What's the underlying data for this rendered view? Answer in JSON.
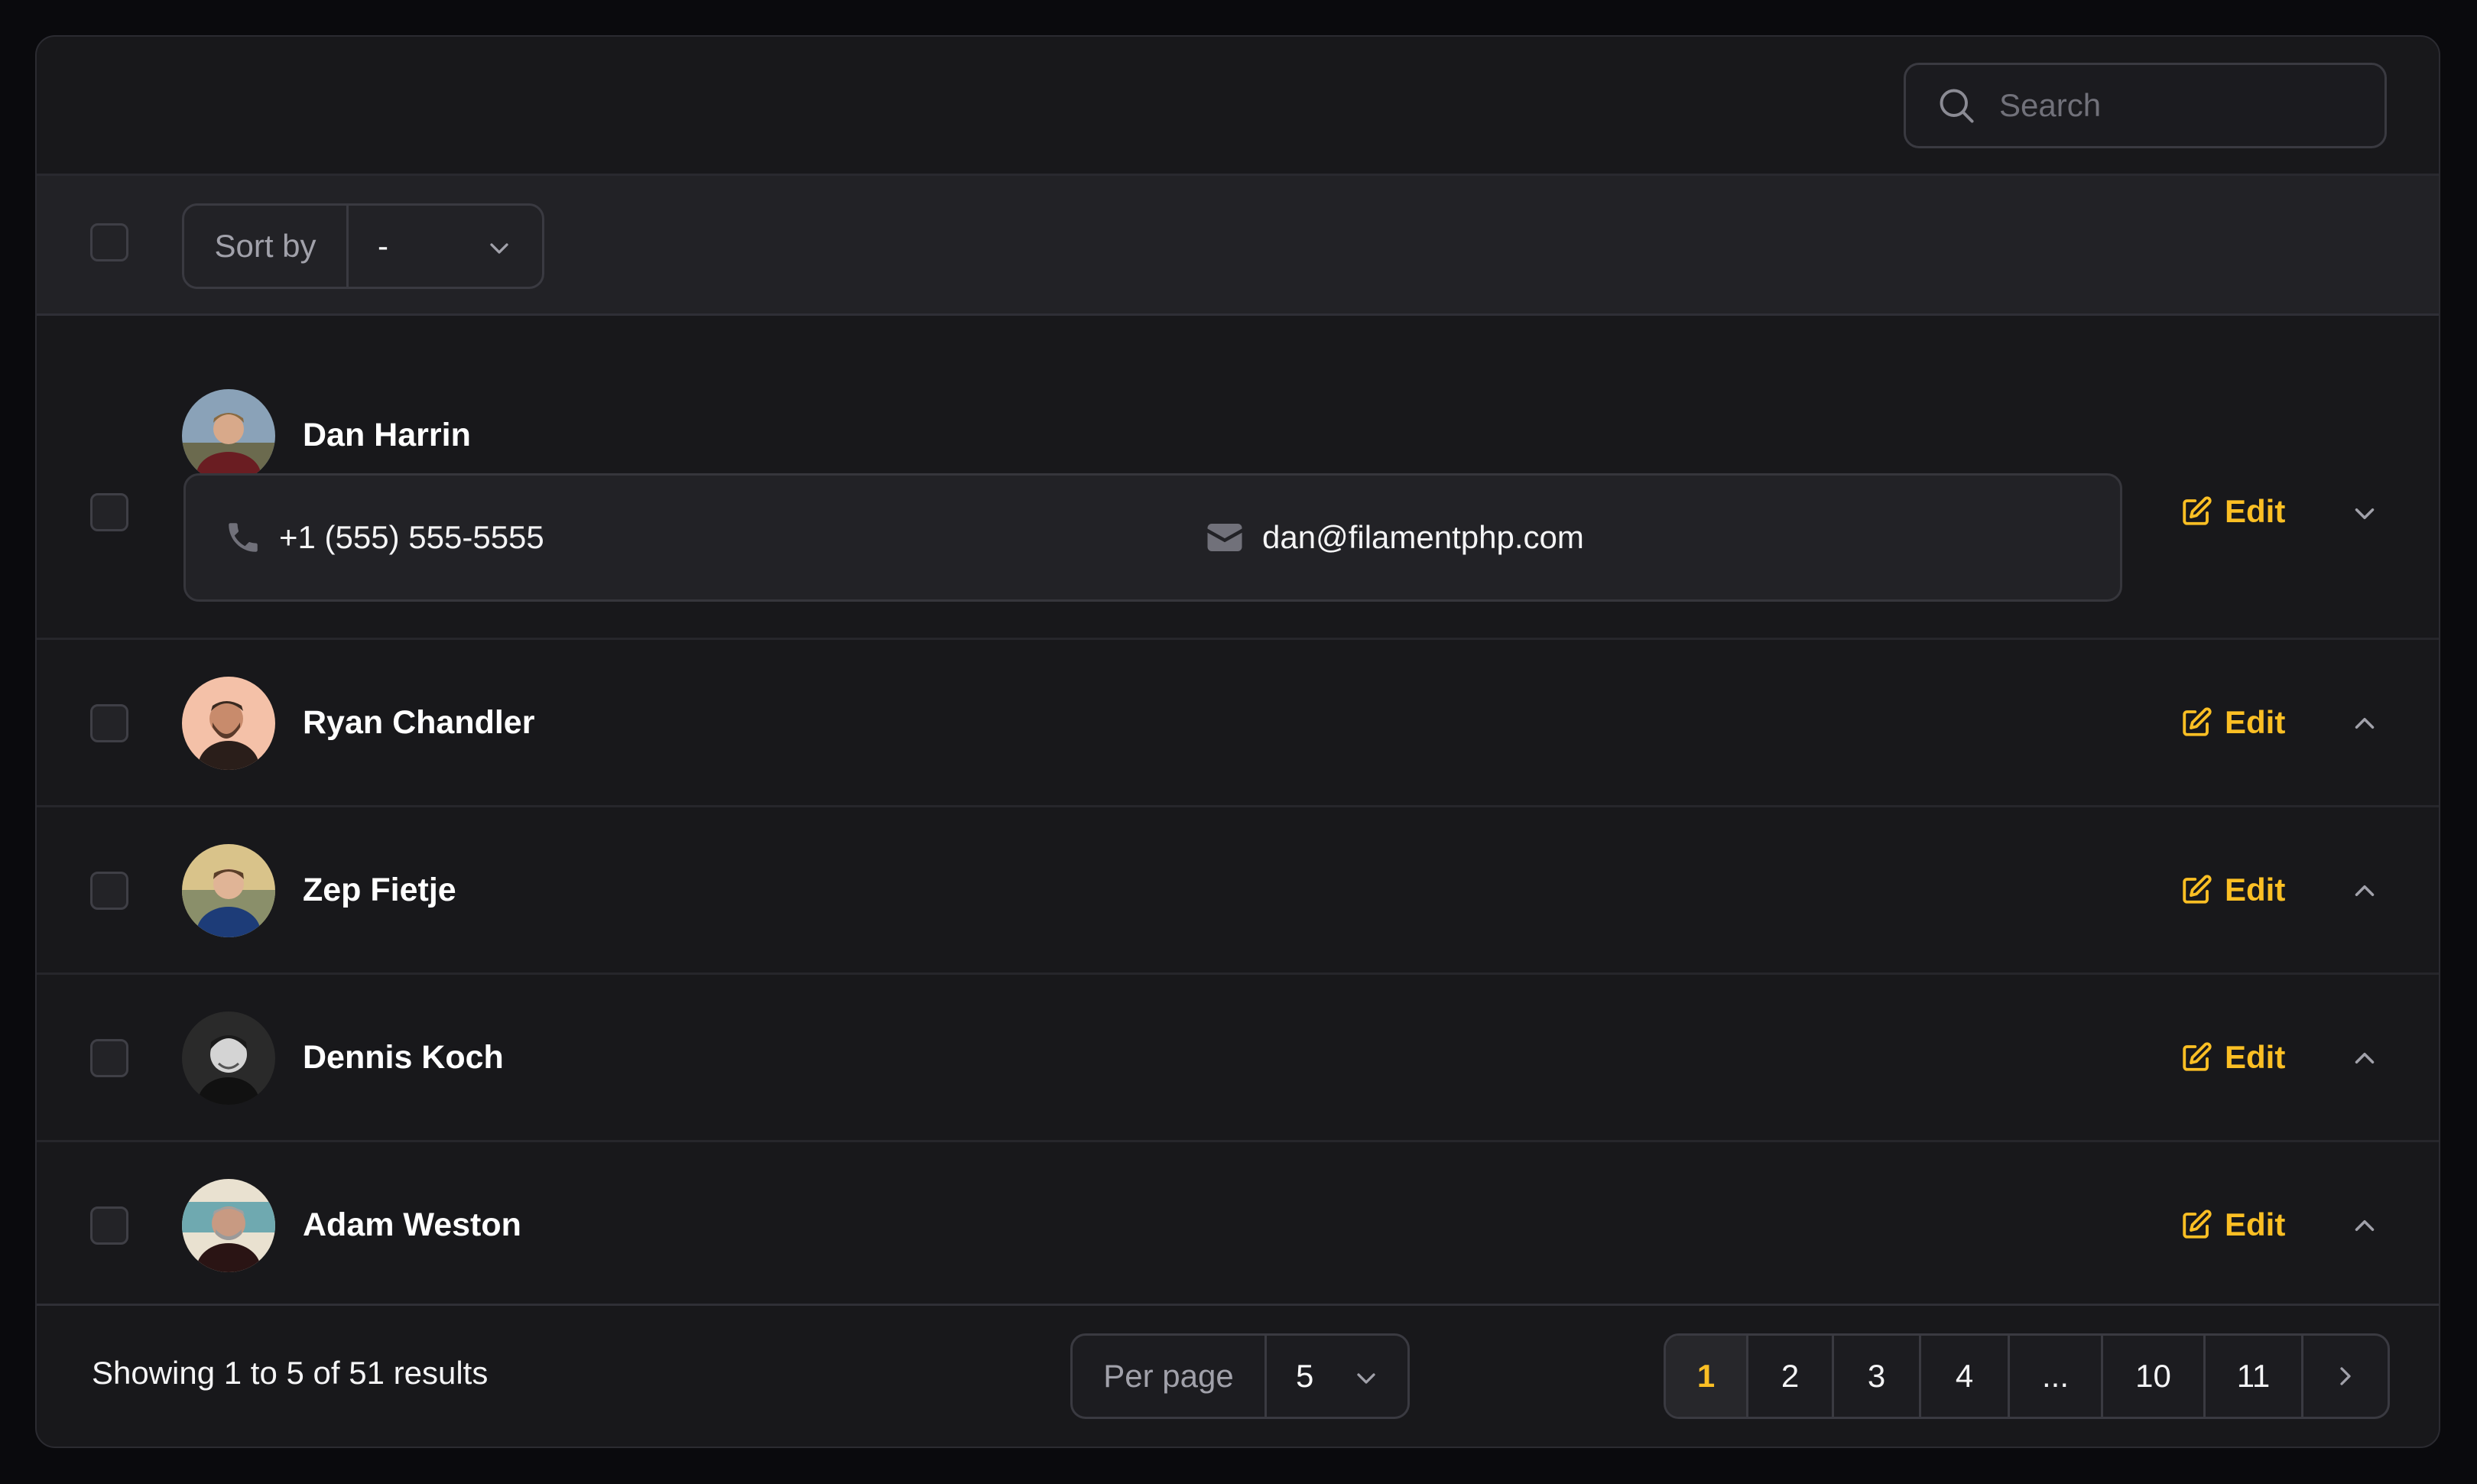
{
  "search": {
    "placeholder": "Search"
  },
  "toolbar": {
    "sort_label": "Sort by",
    "sort_value": "-"
  },
  "rows": [
    {
      "name": "Dan Harrin",
      "expanded": true,
      "phone": "+1 (555) 555-5555",
      "email": "dan@filamentphp.com",
      "edit_label": "Edit"
    },
    {
      "name": "Ryan Chandler",
      "expanded": false,
      "edit_label": "Edit"
    },
    {
      "name": "Zep Fietje",
      "expanded": false,
      "edit_label": "Edit"
    },
    {
      "name": "Dennis Koch",
      "expanded": false,
      "edit_label": "Edit"
    },
    {
      "name": "Adam Weston",
      "expanded": false,
      "edit_label": "Edit"
    }
  ],
  "footer": {
    "showing": "Showing 1 to 5 of 51 results",
    "per_page_label": "Per page",
    "per_page_value": "5",
    "pages": [
      "1",
      "2",
      "3",
      "4",
      "...",
      "10",
      "11"
    ],
    "current_page": "1"
  },
  "colors": {
    "accent": "#fbbf24",
    "background": "#18181b",
    "toolbar": "#222226"
  }
}
